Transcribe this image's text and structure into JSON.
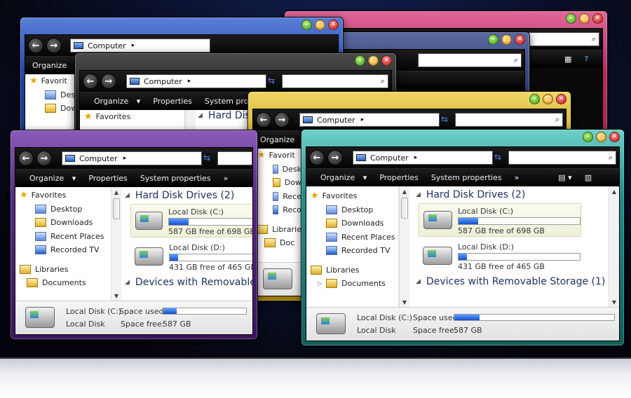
{
  "colors": {
    "pink": "#c4356e",
    "dark_blue": "#2d3c78",
    "black": "#1a1a1a",
    "blue": "#1c3fa0",
    "purple": "#5a2b86",
    "gold": "#c8a21a",
    "teal": "#1f8f8a"
  },
  "icons": {
    "back": "back-arrow-icon",
    "forward": "forward-arrow-icon",
    "computer": "computer-icon",
    "search": "search-icon",
    "refresh": "refresh-icon",
    "drive": "hard-drive-icon"
  },
  "caption_buttons": {
    "minimize": "–",
    "maximize": "□",
    "close": "✕"
  },
  "address": {
    "location": "Computer",
    "chevron": "▸"
  },
  "search": {
    "glyph": "⌕"
  },
  "toolbar": {
    "organize": "Organize",
    "properties": "Properties",
    "system_properties": "System properties",
    "system_propert_truncated": "System propert",
    "more": "»"
  },
  "nav": {
    "favorites": "Favorites",
    "favorites_short": "Favorit",
    "desktop": "Desktop",
    "desktop_short": "Desk",
    "downloads": "Downloads",
    "downloads_short": "Dow",
    "recent_places": "Recent Places",
    "recent_short": "Rece",
    "recorded_tv": "Recorded TV",
    "recorded_short": "Reco",
    "libraries": "Libraries",
    "libraries_short": "Librarie",
    "documents": "Documents",
    "documents_short": "Doc"
  },
  "content": {
    "hard_disk_drives": "Hard Disk Drives (2)",
    "hard_disk_truncated": "Hard Disk Dr",
    "removable": "Devices with Removable Storage (1)",
    "removable_truncated": "Devices with Removable S"
  },
  "drives": [
    {
      "name": "Local Disk (C:)",
      "free_text": "587 GB free of 698 GB",
      "used_fraction": 0.16
    },
    {
      "name": "Local Disk (D:)",
      "free_text": "431 GB free of 465 GB",
      "used_fraction": 0.07
    }
  ],
  "details": {
    "title": "Local Disk (C:)",
    "type": "Local Disk",
    "space_used_label": "Space used:",
    "space_free_label": "Space free:",
    "space_free_value": "587 GB",
    "used_fraction": 0.16
  }
}
